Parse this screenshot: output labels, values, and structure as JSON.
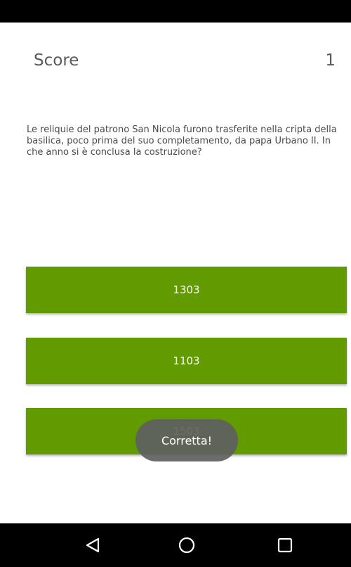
{
  "score": {
    "label": "Score",
    "value": "1"
  },
  "question": {
    "text": "Le reliquie del patrono San Nicola furono trasferite nella cripta della basilica, poco prima del suo completamento, da papa Urbano II. In che anno si è conclusa la costruzione?"
  },
  "answers": [
    {
      "label": "1303"
    },
    {
      "label": "1103"
    },
    {
      "label": "1503"
    }
  ],
  "toast": {
    "text": "Corretta!"
  },
  "colors": {
    "answer_button": "#619b00",
    "toast_background": "#5f5f5f",
    "system_bars": "#000000"
  },
  "navigation": {
    "icons": [
      "back-icon",
      "home-icon",
      "recents-icon"
    ]
  }
}
